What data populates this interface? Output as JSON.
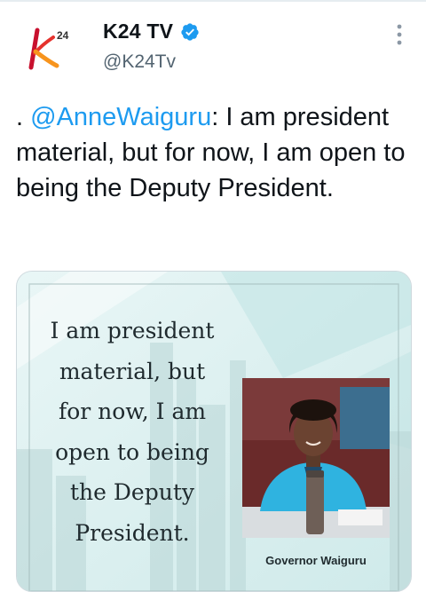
{
  "account": {
    "display_name": "K24 TV",
    "handle": "@K24Tv",
    "verified": true,
    "avatar_icon": "k24-logo-icon",
    "avatar_superscript": "24"
  },
  "menu": {
    "icon": "more-vertical-icon"
  },
  "tweet": {
    "prefix": ". ",
    "mention": "@AnneWaiguru",
    "body": ": I am president material, but for now, I am open to being the Deputy President."
  },
  "media": {
    "quote": "I am president material, but for now, I am open to being the Deputy President.",
    "caption": "Governor Waiguru",
    "photo_icon": "governor-photo"
  },
  "colors": {
    "accent": "#1d9bf0",
    "text": "#0f1419",
    "secondary": "#536471",
    "media_bg": "#dff1f1",
    "logo_red": "#c8102e",
    "logo_orange": "#f7941d"
  }
}
